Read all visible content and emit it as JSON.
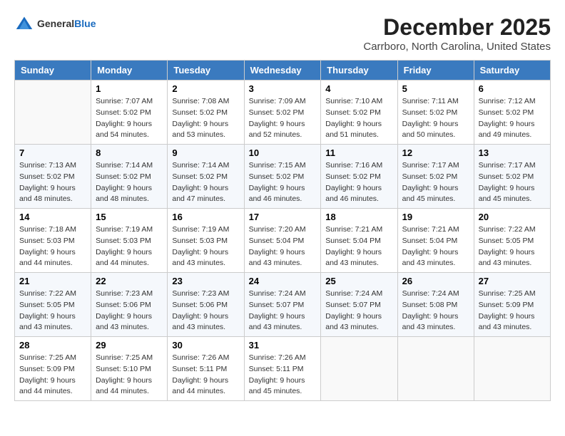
{
  "logo": {
    "general": "General",
    "blue": "Blue"
  },
  "title": {
    "month_year": "December 2025",
    "location": "Carrboro, North Carolina, United States"
  },
  "days_of_week": [
    "Sunday",
    "Monday",
    "Tuesday",
    "Wednesday",
    "Thursday",
    "Friday",
    "Saturday"
  ],
  "weeks": [
    [
      {
        "day": "",
        "sunrise": "",
        "sunset": "",
        "daylight": "",
        "empty": true
      },
      {
        "day": "1",
        "sunrise": "Sunrise: 7:07 AM",
        "sunset": "Sunset: 5:02 PM",
        "daylight": "Daylight: 9 hours and 54 minutes."
      },
      {
        "day": "2",
        "sunrise": "Sunrise: 7:08 AM",
        "sunset": "Sunset: 5:02 PM",
        "daylight": "Daylight: 9 hours and 53 minutes."
      },
      {
        "day": "3",
        "sunrise": "Sunrise: 7:09 AM",
        "sunset": "Sunset: 5:02 PM",
        "daylight": "Daylight: 9 hours and 52 minutes."
      },
      {
        "day": "4",
        "sunrise": "Sunrise: 7:10 AM",
        "sunset": "Sunset: 5:02 PM",
        "daylight": "Daylight: 9 hours and 51 minutes."
      },
      {
        "day": "5",
        "sunrise": "Sunrise: 7:11 AM",
        "sunset": "Sunset: 5:02 PM",
        "daylight": "Daylight: 9 hours and 50 minutes."
      },
      {
        "day": "6",
        "sunrise": "Sunrise: 7:12 AM",
        "sunset": "Sunset: 5:02 PM",
        "daylight": "Daylight: 9 hours and 49 minutes."
      }
    ],
    [
      {
        "day": "7",
        "sunrise": "Sunrise: 7:13 AM",
        "sunset": "Sunset: 5:02 PM",
        "daylight": "Daylight: 9 hours and 48 minutes."
      },
      {
        "day": "8",
        "sunrise": "Sunrise: 7:14 AM",
        "sunset": "Sunset: 5:02 PM",
        "daylight": "Daylight: 9 hours and 48 minutes."
      },
      {
        "day": "9",
        "sunrise": "Sunrise: 7:14 AM",
        "sunset": "Sunset: 5:02 PM",
        "daylight": "Daylight: 9 hours and 47 minutes."
      },
      {
        "day": "10",
        "sunrise": "Sunrise: 7:15 AM",
        "sunset": "Sunset: 5:02 PM",
        "daylight": "Daylight: 9 hours and 46 minutes."
      },
      {
        "day": "11",
        "sunrise": "Sunrise: 7:16 AM",
        "sunset": "Sunset: 5:02 PM",
        "daylight": "Daylight: 9 hours and 46 minutes."
      },
      {
        "day": "12",
        "sunrise": "Sunrise: 7:17 AM",
        "sunset": "Sunset: 5:02 PM",
        "daylight": "Daylight: 9 hours and 45 minutes."
      },
      {
        "day": "13",
        "sunrise": "Sunrise: 7:17 AM",
        "sunset": "Sunset: 5:02 PM",
        "daylight": "Daylight: 9 hours and 45 minutes."
      }
    ],
    [
      {
        "day": "14",
        "sunrise": "Sunrise: 7:18 AM",
        "sunset": "Sunset: 5:03 PM",
        "daylight": "Daylight: 9 hours and 44 minutes."
      },
      {
        "day": "15",
        "sunrise": "Sunrise: 7:19 AM",
        "sunset": "Sunset: 5:03 PM",
        "daylight": "Daylight: 9 hours and 44 minutes."
      },
      {
        "day": "16",
        "sunrise": "Sunrise: 7:19 AM",
        "sunset": "Sunset: 5:03 PM",
        "daylight": "Daylight: 9 hours and 43 minutes."
      },
      {
        "day": "17",
        "sunrise": "Sunrise: 7:20 AM",
        "sunset": "Sunset: 5:04 PM",
        "daylight": "Daylight: 9 hours and 43 minutes."
      },
      {
        "day": "18",
        "sunrise": "Sunrise: 7:21 AM",
        "sunset": "Sunset: 5:04 PM",
        "daylight": "Daylight: 9 hours and 43 minutes."
      },
      {
        "day": "19",
        "sunrise": "Sunrise: 7:21 AM",
        "sunset": "Sunset: 5:04 PM",
        "daylight": "Daylight: 9 hours and 43 minutes."
      },
      {
        "day": "20",
        "sunrise": "Sunrise: 7:22 AM",
        "sunset": "Sunset: 5:05 PM",
        "daylight": "Daylight: 9 hours and 43 minutes."
      }
    ],
    [
      {
        "day": "21",
        "sunrise": "Sunrise: 7:22 AM",
        "sunset": "Sunset: 5:05 PM",
        "daylight": "Daylight: 9 hours and 43 minutes."
      },
      {
        "day": "22",
        "sunrise": "Sunrise: 7:23 AM",
        "sunset": "Sunset: 5:06 PM",
        "daylight": "Daylight: 9 hours and 43 minutes."
      },
      {
        "day": "23",
        "sunrise": "Sunrise: 7:23 AM",
        "sunset": "Sunset: 5:06 PM",
        "daylight": "Daylight: 9 hours and 43 minutes."
      },
      {
        "day": "24",
        "sunrise": "Sunrise: 7:24 AM",
        "sunset": "Sunset: 5:07 PM",
        "daylight": "Daylight: 9 hours and 43 minutes."
      },
      {
        "day": "25",
        "sunrise": "Sunrise: 7:24 AM",
        "sunset": "Sunset: 5:07 PM",
        "daylight": "Daylight: 9 hours and 43 minutes."
      },
      {
        "day": "26",
        "sunrise": "Sunrise: 7:24 AM",
        "sunset": "Sunset: 5:08 PM",
        "daylight": "Daylight: 9 hours and 43 minutes."
      },
      {
        "day": "27",
        "sunrise": "Sunrise: 7:25 AM",
        "sunset": "Sunset: 5:09 PM",
        "daylight": "Daylight: 9 hours and 43 minutes."
      }
    ],
    [
      {
        "day": "28",
        "sunrise": "Sunrise: 7:25 AM",
        "sunset": "Sunset: 5:09 PM",
        "daylight": "Daylight: 9 hours and 44 minutes."
      },
      {
        "day": "29",
        "sunrise": "Sunrise: 7:25 AM",
        "sunset": "Sunset: 5:10 PM",
        "daylight": "Daylight: 9 hours and 44 minutes."
      },
      {
        "day": "30",
        "sunrise": "Sunrise: 7:26 AM",
        "sunset": "Sunset: 5:11 PM",
        "daylight": "Daylight: 9 hours and 44 minutes."
      },
      {
        "day": "31",
        "sunrise": "Sunrise: 7:26 AM",
        "sunset": "Sunset: 5:11 PM",
        "daylight": "Daylight: 9 hours and 45 minutes."
      },
      {
        "day": "",
        "sunrise": "",
        "sunset": "",
        "daylight": "",
        "empty": true
      },
      {
        "day": "",
        "sunrise": "",
        "sunset": "",
        "daylight": "",
        "empty": true
      },
      {
        "day": "",
        "sunrise": "",
        "sunset": "",
        "daylight": "",
        "empty": true
      }
    ]
  ]
}
